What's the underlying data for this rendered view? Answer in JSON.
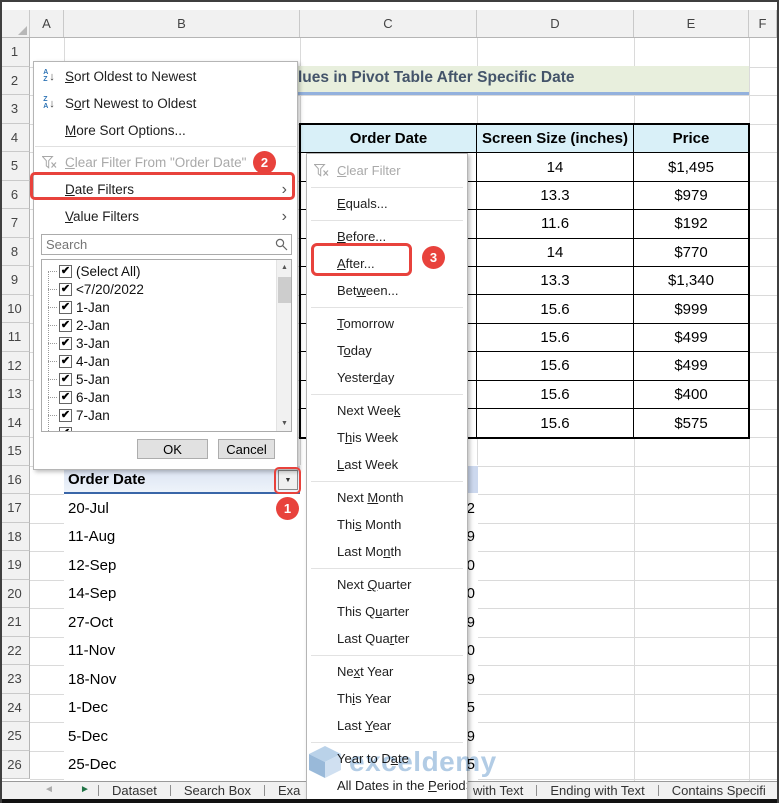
{
  "sheet": {
    "columns": [
      "A",
      "B",
      "C",
      "D",
      "E",
      "F"
    ],
    "row_count": 26
  },
  "title": {
    "visible_text": "lues in Pivot Table After Specific Date"
  },
  "filter_menu": {
    "items": [
      {
        "label": "Sort Oldest to Newest",
        "u": 0,
        "icon": "sort-az"
      },
      {
        "label": "Sort Newest to Oldest",
        "u": 1,
        "icon": "sort-za"
      },
      {
        "label": "More Sort Options...",
        "u": 0,
        "icon": "none"
      },
      {
        "label": "Clear Filter From \"Order Date\"",
        "u": 0,
        "icon": "clear-filter",
        "disabled": true,
        "sep_before": true
      },
      {
        "label": "Date Filters",
        "u": 0,
        "icon": "none",
        "arrow": true,
        "highlight": true
      },
      {
        "label": "Value Filters",
        "u": 0,
        "icon": "none",
        "arrow": true
      }
    ],
    "search_placeholder": "Search",
    "checkbox_items": [
      "(Select All)",
      "<7/20/2022",
      "1-Jan",
      "2-Jan",
      "3-Jan",
      "4-Jan",
      "5-Jan",
      "6-Jan",
      "7-Jan"
    ],
    "ok_label": "OK",
    "cancel_label": "Cancel"
  },
  "date_filters_submenu": {
    "groups": [
      [
        {
          "label": "Clear Filter",
          "u": 0,
          "icon": "clear-filter",
          "disabled": true
        }
      ],
      [
        {
          "label": "Equals...",
          "u": 0
        }
      ],
      [
        {
          "label": "Before...",
          "u": 0
        },
        {
          "label": "After...",
          "u": 0,
          "highlight": true
        },
        {
          "label": "Between...",
          "u": 3
        }
      ],
      [
        {
          "label": "Tomorrow",
          "u": 0
        },
        {
          "label": "Today",
          "u": 1
        },
        {
          "label": "Yesterday",
          "u": 6
        }
      ],
      [
        {
          "label": "Next Week",
          "u": 8
        },
        {
          "label": "This Week",
          "u": 1
        },
        {
          "label": "Last Week",
          "u": 0
        }
      ],
      [
        {
          "label": "Next Month",
          "u": 5
        },
        {
          "label": "This Month",
          "u": 3
        },
        {
          "label": "Last Month",
          "u": 7
        }
      ],
      [
        {
          "label": "Next Quarter",
          "u": 5
        },
        {
          "label": "This Quarter",
          "u": 6
        },
        {
          "label": "Last Quarter",
          "u": 8
        }
      ],
      [
        {
          "label": "Next Year",
          "u": 2
        },
        {
          "label": "This Year",
          "u": 2
        },
        {
          "label": "Last Year",
          "u": 5
        }
      ],
      [
        {
          "label": "Year to Date",
          "u": 9
        },
        {
          "label": "All Dates in the Period",
          "u": 17,
          "arrow": true
        }
      ]
    ]
  },
  "table": {
    "headers": [
      "Order Date",
      "Screen Size (inches)",
      "Price"
    ],
    "rows": [
      {
        "screen_size": "14",
        "price": "$1,495"
      },
      {
        "screen_size": "13.3",
        "price": "$979"
      },
      {
        "screen_size": "11.6",
        "price": "$192"
      },
      {
        "screen_size": "14",
        "price": "$770"
      },
      {
        "screen_size": "13.3",
        "price": "$1,340"
      },
      {
        "screen_size": "15.6",
        "price": "$999"
      },
      {
        "screen_size": "15.6",
        "price": "$499"
      },
      {
        "screen_size": "15.6",
        "price": "$499"
      },
      {
        "screen_size": "15.6",
        "price": "$400"
      },
      {
        "screen_size": "15.6",
        "price": "$575"
      }
    ]
  },
  "pivot": {
    "header": "Order Date",
    "dates": [
      "20-Jul",
      "11-Aug",
      "12-Sep",
      "14-Sep",
      "27-Oct",
      "11-Nov",
      "18-Nov",
      "1-Dec",
      "5-Dec",
      "25-Dec"
    ],
    "value_fragments": [
      "2",
      "9",
      "0",
      "0",
      "9",
      "0",
      "9",
      "5",
      "9",
      "5"
    ]
  },
  "badges": {
    "b1": "1",
    "b2": "2",
    "b3": "3"
  },
  "sheet_tabs": {
    "left": [
      "Dataset",
      "Search Box",
      "Exa"
    ],
    "right": [
      "with Text",
      "Ending with Text",
      "Contains Specifi"
    ]
  },
  "watermark": {
    "text": "exceldemy"
  },
  "colors": {
    "accent_red": "#e8423c",
    "title_green": "#e8efdd",
    "header_cyan": "#d9f0f8",
    "selection_blue": "#ccd8ee"
  }
}
